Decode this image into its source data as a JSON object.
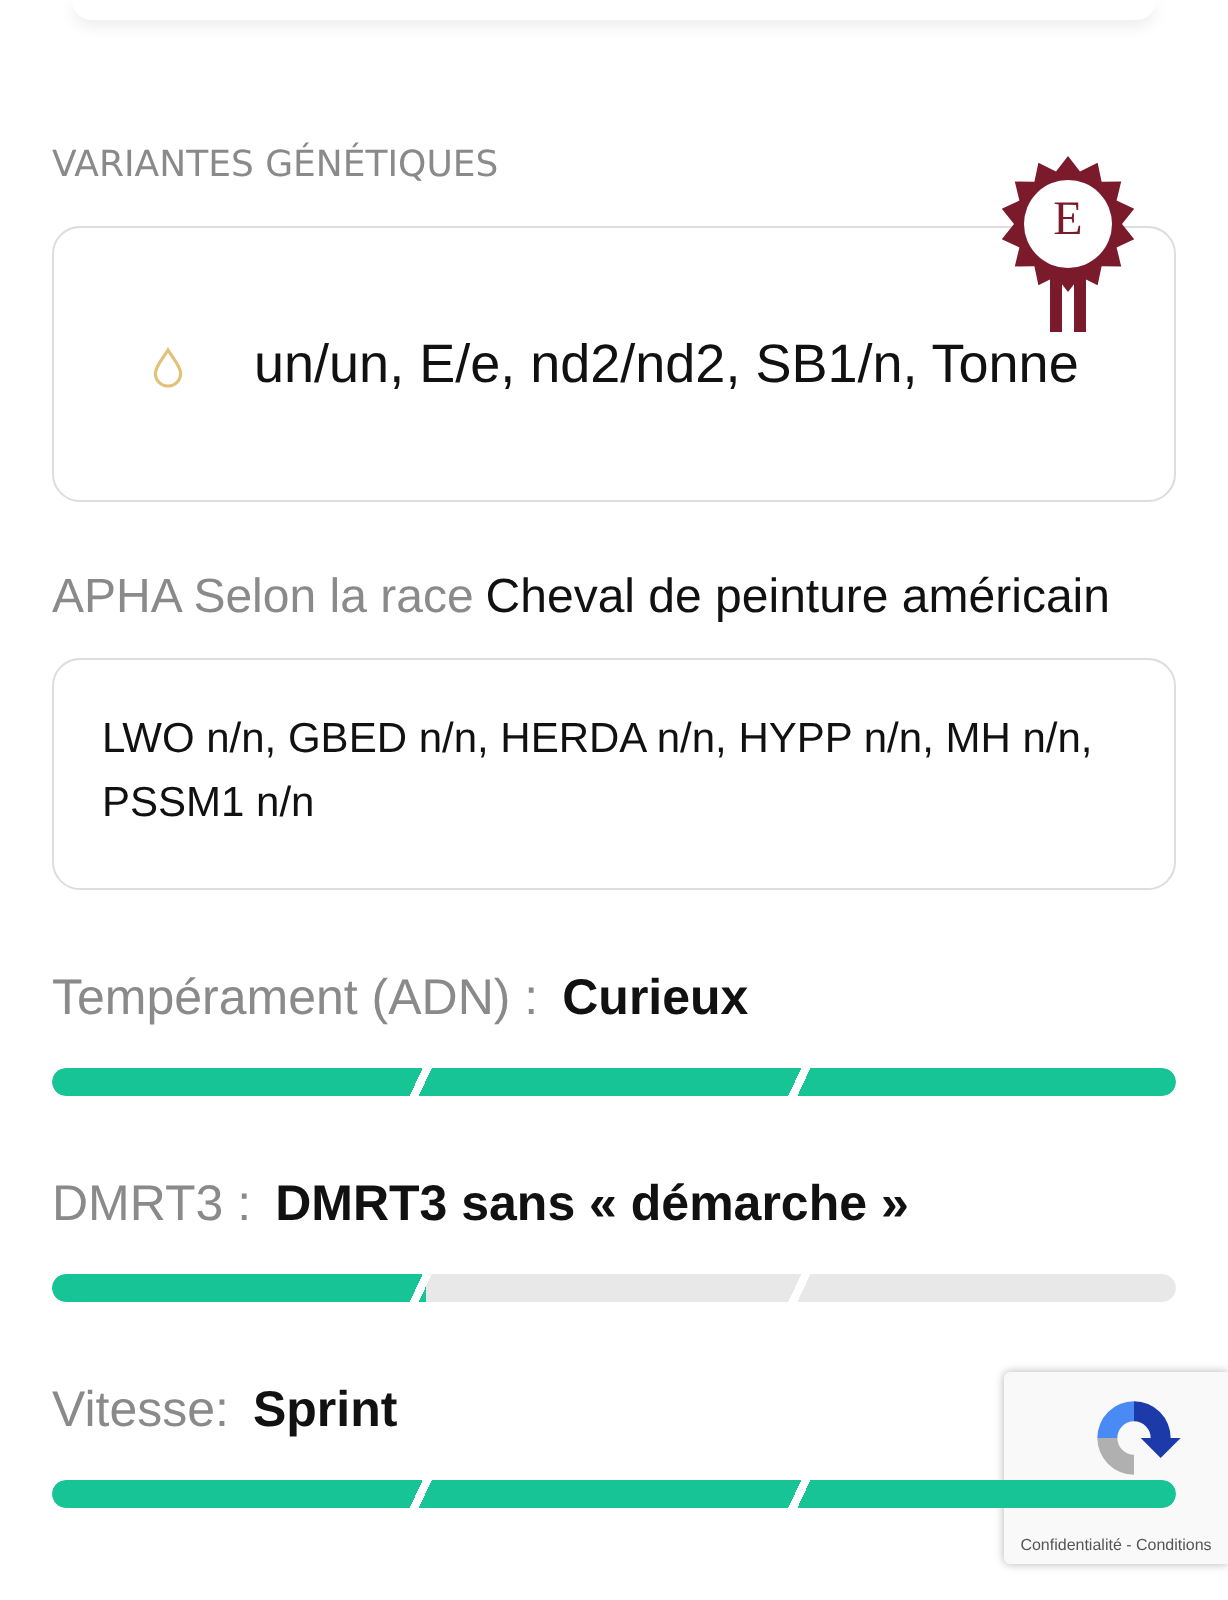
{
  "genetic_variants": {
    "heading": "VARIANTES GÉNÉTIQUES",
    "badge_letter": "E",
    "value": "un/un, E/e, nd2/nd2, SB1/n, Tonne"
  },
  "breed": {
    "registry": "APHA",
    "label": "Selon la race",
    "name": "Cheval de peinture américain",
    "tests": "LWO n/n, GBED n/n, HERDA n/n, HYPP n/n, MH n/n, PSSM1 n/n"
  },
  "traits": [
    {
      "label": "Tempérament (ADN) :",
      "value": "Curieux",
      "level": 1
    },
    {
      "label": "DMRT3 :",
      "value": "DMRT3 sans « démarche »",
      "level": 0.3333
    },
    {
      "label": "Vitesse:",
      "value": "Sprint",
      "level": 1
    }
  ],
  "recaptcha": {
    "links": "Confidentialité - Conditions"
  }
}
